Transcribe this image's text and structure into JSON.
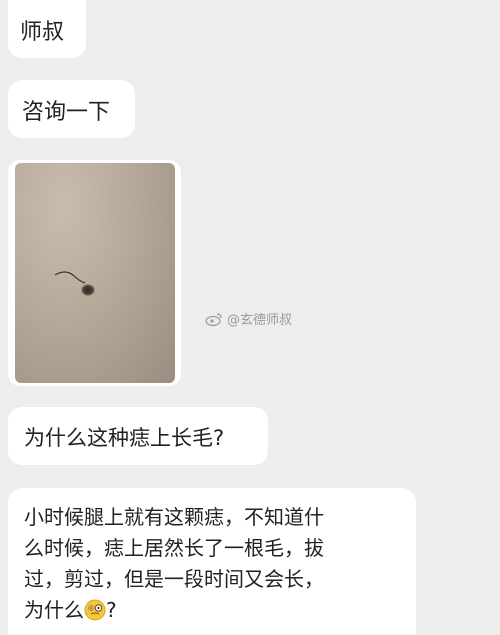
{
  "messages": [
    {
      "text": "师叔"
    },
    {
      "text": "咨询一下"
    },
    {
      "text": "为什么这种痣上长毛?"
    },
    {
      "lines": [
        "小时候腿上就有这颗痣，不知道什",
        "么时候，痣上居然长了一根毛，拔",
        "过，剪过，但是一段时间又会长，",
        "为什么"
      ],
      "suffix": "?"
    }
  ],
  "watermark": {
    "text": "@玄德师叔",
    "icon": "weibo-icon"
  },
  "emoji": "thinking-monocle-face",
  "colors": {
    "background": "#ededed",
    "bubble": "#ffffff",
    "text": "#222222"
  }
}
